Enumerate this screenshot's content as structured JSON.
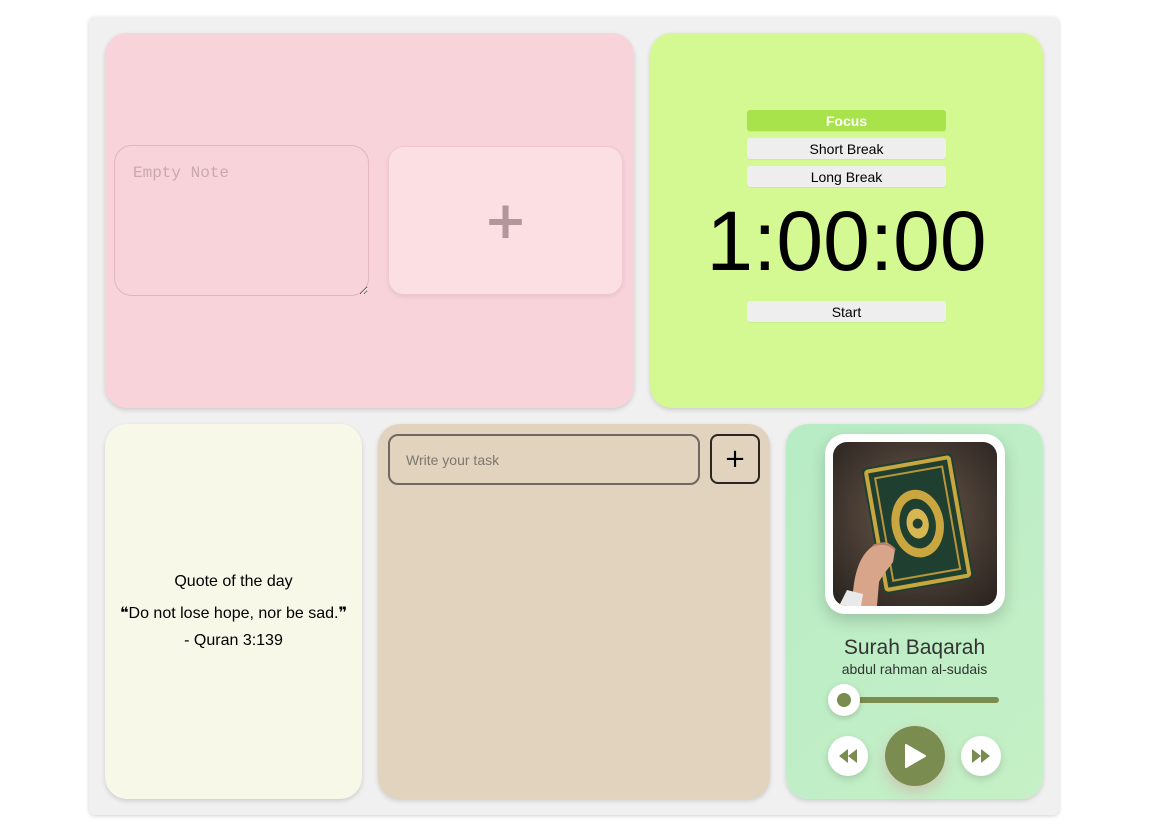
{
  "notes": {
    "note_placeholder": "Empty Note",
    "add_note_label": "+"
  },
  "timer": {
    "modes": [
      "Focus",
      "Short Break",
      "Long Break"
    ],
    "active_mode": "Focus",
    "time": "1:00:00",
    "start_label": "Start"
  },
  "quote": {
    "title": "Quote of the day",
    "text": "❝Do not lose hope, nor be sad.❞",
    "source": "- Quran 3:139"
  },
  "tasks": {
    "input_placeholder": "Write your task",
    "add_label": "+"
  },
  "player": {
    "cover_icon": "quran-book-cover",
    "song": "Surah Baqarah",
    "artist": "abdul rahman al-sudais",
    "progress": 0.0,
    "controls": [
      "rewind-icon",
      "play-icon",
      "fast-forward-icon"
    ],
    "accent": "#7b8c50"
  },
  "colors": {
    "notes_bg": "#f8d3da",
    "timer_bg": "#d5f992",
    "timer_active": "#a9e34b",
    "quote_bg": "#f7f8e8",
    "tasks_bg": "#e1d3be",
    "player_bg": "#c6f0c6"
  }
}
